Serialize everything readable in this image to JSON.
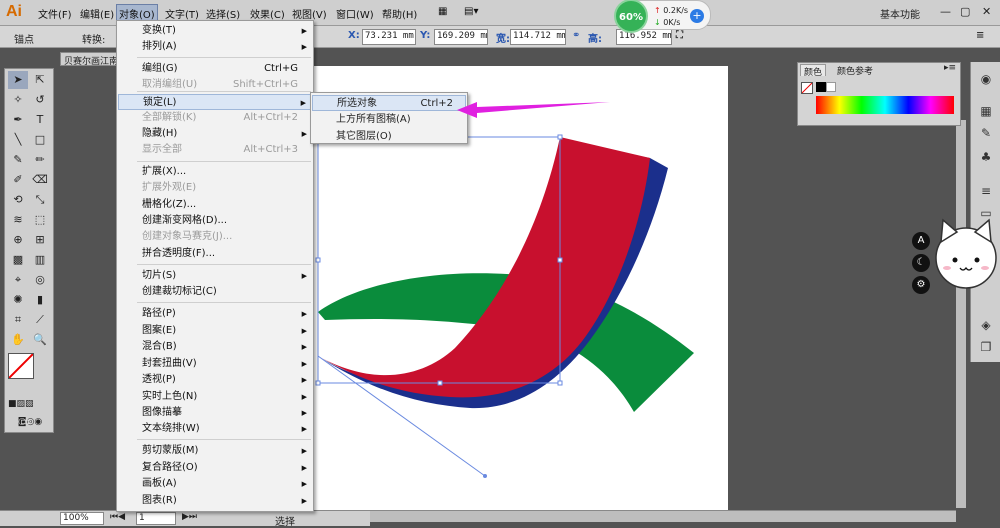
{
  "app": {
    "logo": "Ai",
    "workspace": "基本功能",
    "window_controls": [
      "—",
      "▢",
      "✕"
    ]
  },
  "menubar": [
    "文件(F)",
    "编辑(E)",
    "对象(O)",
    "文字(T)",
    "选择(S)",
    "效果(C)",
    "视图(V)",
    "窗口(W)",
    "帮助(H)"
  ],
  "control_bar": {
    "mode": "锚点",
    "convert_label": "转换:",
    "x_label": "X:",
    "x_value": "73.231 mm",
    "y_label": "Y:",
    "y_value": "169.209 mm",
    "w_label": "宽:",
    "w_value": "114.712 mm",
    "h_label": "高:",
    "h_value": "116.952 mm"
  },
  "net_monitor": {
    "percent": "60%",
    "up": "0.2K/s",
    "down": "0K/s",
    "plus": "+"
  },
  "document_tab": "贝赛尔画江南",
  "object_menu": {
    "items": [
      {
        "label": "变换(T)",
        "shortcut": "",
        "submenu": true,
        "disabled": false
      },
      {
        "label": "排列(A)",
        "shortcut": "",
        "submenu": true,
        "disabled": false
      },
      {
        "label": "编组(G)",
        "shortcut": "Ctrl+G",
        "submenu": false,
        "disabled": false
      },
      {
        "label": "取消编组(U)",
        "shortcut": "Shift+Ctrl+G",
        "submenu": false,
        "disabled": true
      },
      {
        "label": "锁定(L)",
        "shortcut": "",
        "submenu": true,
        "disabled": false,
        "highlighted": true
      },
      {
        "label": "全部解锁(K)",
        "shortcut": "Alt+Ctrl+2",
        "submenu": false,
        "disabled": true
      },
      {
        "label": "隐藏(H)",
        "shortcut": "",
        "submenu": true,
        "disabled": false
      },
      {
        "label": "显示全部",
        "shortcut": "Alt+Ctrl+3",
        "submenu": false,
        "disabled": true
      },
      {
        "label": "扩展(X)...",
        "shortcut": "",
        "submenu": false,
        "disabled": false
      },
      {
        "label": "扩展外观(E)",
        "shortcut": "",
        "submenu": false,
        "disabled": true
      },
      {
        "label": "栅格化(Z)...",
        "shortcut": "",
        "submenu": false,
        "disabled": false
      },
      {
        "label": "创建渐变网格(D)...",
        "shortcut": "",
        "submenu": false,
        "disabled": false
      },
      {
        "label": "创建对象马赛克(J)...",
        "shortcut": "",
        "submenu": false,
        "disabled": true
      },
      {
        "label": "拼合透明度(F)...",
        "shortcut": "",
        "submenu": false,
        "disabled": false
      },
      {
        "label": "切片(S)",
        "shortcut": "",
        "submenu": true,
        "disabled": false
      },
      {
        "label": "创建裁切标记(C)",
        "shortcut": "",
        "submenu": false,
        "disabled": false
      },
      {
        "label": "路径(P)",
        "shortcut": "",
        "submenu": true,
        "disabled": false
      },
      {
        "label": "图案(E)",
        "shortcut": "",
        "submenu": true,
        "disabled": false
      },
      {
        "label": "混合(B)",
        "shortcut": "",
        "submenu": true,
        "disabled": false
      },
      {
        "label": "封套扭曲(V)",
        "shortcut": "",
        "submenu": true,
        "disabled": false
      },
      {
        "label": "透视(P)",
        "shortcut": "",
        "submenu": true,
        "disabled": false
      },
      {
        "label": "实时上色(N)",
        "shortcut": "",
        "submenu": true,
        "disabled": false
      },
      {
        "label": "图像描摹",
        "shortcut": "",
        "submenu": true,
        "disabled": false
      },
      {
        "label": "文本绕排(W)",
        "shortcut": "",
        "submenu": true,
        "disabled": false
      },
      {
        "label": "剪切蒙版(M)",
        "shortcut": "",
        "submenu": true,
        "disabled": false
      },
      {
        "label": "复合路径(O)",
        "shortcut": "",
        "submenu": true,
        "disabled": false
      },
      {
        "label": "画板(A)",
        "shortcut": "",
        "submenu": true,
        "disabled": false
      },
      {
        "label": "图表(R)",
        "shortcut": "",
        "submenu": true,
        "disabled": false
      }
    ]
  },
  "lock_submenu": [
    {
      "label": "所选对象",
      "shortcut": "Ctrl+2",
      "highlighted": true
    },
    {
      "label": "上方所有图稿(A)",
      "shortcut": ""
    },
    {
      "label": "其它图层(O)",
      "shortcut": ""
    }
  ],
  "color_panel": {
    "tabs": [
      "颜色",
      "颜色参考"
    ]
  },
  "status": {
    "zoom": "100%",
    "page": "1",
    "tool": "选择"
  },
  "colors": {
    "red": "#c8102e",
    "navy": "#1b2f8c",
    "green": "#0a8c3c",
    "pointer": "#e020e0"
  }
}
